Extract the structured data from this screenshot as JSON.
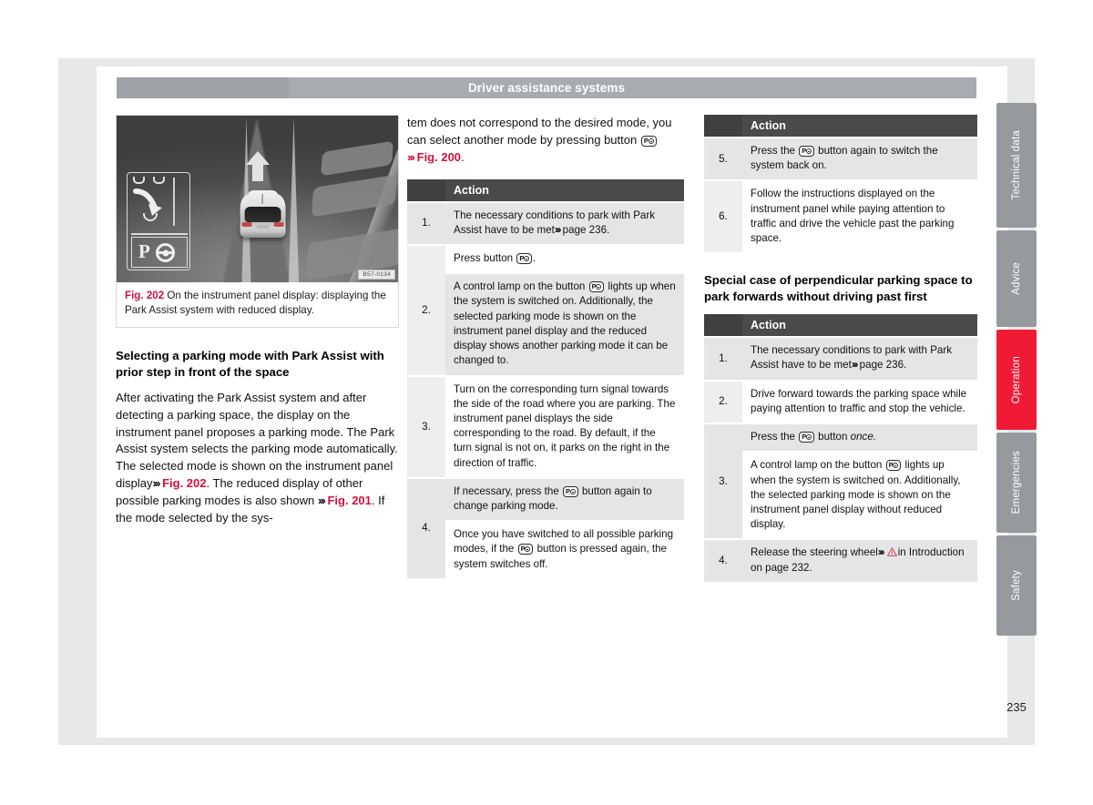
{
  "header": {
    "title": "Driver assistance systems"
  },
  "page_number": "235",
  "figure": {
    "code": "B57-0134",
    "label": "Fig. 202",
    "caption": "On the instrument panel display: displaying the Park Assist system with reduced display."
  },
  "left_column": {
    "heading": "Selecting a parking mode with Park Assist with prior step in front of the space",
    "paragraph_part1": "After activating the Park Assist system and after detecting a parking space, the display on the instrument panel proposes a parking mode. The Park Assist system selects the parking mode automatically. The selected mode is shown on the instrument panel display",
    "ref1": "Fig. 202",
    "paragraph_part2": ". The reduced display of other possible parking modes is also shown",
    "ref2": "Fig. 201",
    "paragraph_part3": ". If the mode selected by the sys-"
  },
  "middle_column": {
    "intro_part1": "tem does not correspond to the desired mode, you can select another mode by pressing button",
    "intro_ref": "Fig. 200",
    "intro_part2": ".",
    "table": {
      "header_num": "",
      "header_action": "Action",
      "rows": [
        {
          "num": "1.",
          "cells": [
            {
              "shade": true,
              "text_before": "The necessary conditions to park with Park Assist have to be met",
              "chevron": true,
              "text_after": "page 236.",
              "button": false
            }
          ]
        },
        {
          "num": "2.",
          "cells": [
            {
              "shade": false,
              "text_before": "Press button",
              "button": true,
              "text_after": "."
            },
            {
              "shade": true,
              "text_before": "A control lamp on the button",
              "button": true,
              "text_after": "lights up when the system is switched on. Additionally, the selected parking mode is shown on the instrument panel display and the reduced display shows another parking mode it can be changed to."
            }
          ]
        },
        {
          "num": "3.",
          "cells": [
            {
              "shade": false,
              "text_before": "Turn on the corresponding turn signal towards the side of the road where you are parking. The instrument panel displays the side corresponding to the road. By default, if the turn signal is not on, it parks on the right in the direction of traffic.",
              "button": false,
              "text_after": ""
            }
          ]
        },
        {
          "num": "4.",
          "cells": [
            {
              "shade": true,
              "text_before": "If necessary, press the",
              "button": true,
              "text_after": "button again to change parking mode."
            },
            {
              "shade": false,
              "text_before": "Once you have switched to all possible parking modes, if the",
              "button": true,
              "text_after": "button is pressed again, the system switches off."
            }
          ]
        }
      ]
    }
  },
  "right_column": {
    "table1": {
      "header_num": "",
      "header_action": "Action",
      "rows": [
        {
          "num": "5.",
          "cells": [
            {
              "shade": true,
              "text_before": "Press the",
              "button": true,
              "text_after": "button again to switch the system back on."
            }
          ]
        },
        {
          "num": "6.",
          "cells": [
            {
              "shade": false,
              "text_before": "Follow the instructions displayed on the instrument panel while paying attention to traffic and drive the vehicle past the parking space.",
              "button": false,
              "text_after": ""
            }
          ]
        }
      ]
    },
    "heading": "Special case of perpendicular parking space to park forwards without driving past first",
    "table2": {
      "header_num": "",
      "header_action": "Action",
      "rows": [
        {
          "num": "1.",
          "cells": [
            {
              "shade": true,
              "text_before": "The necessary conditions to park with Park Assist have to be met",
              "chevron": true,
              "text_after": "page 236.",
              "button": false
            }
          ]
        },
        {
          "num": "2.",
          "cells": [
            {
              "shade": false,
              "text_before": "Drive forward towards the parking space while paying attention to traffic and stop the vehicle.",
              "button": false,
              "text_after": ""
            }
          ]
        },
        {
          "num": "3.",
          "cells": [
            {
              "shade": true,
              "text_before": "Press the",
              "button": true,
              "text_after": "button ",
              "italic_tail": "once."
            },
            {
              "shade": false,
              "text_before": "A control lamp on the button",
              "button": true,
              "text_after": "lights up when the system is switched on. Additionally, the selected parking mode is shown on the instrument panel display without reduced display."
            }
          ]
        },
        {
          "num": "4.",
          "cells": [
            {
              "shade": true,
              "text_before": "Release the steering wheel",
              "chevron": true,
              "warning": true,
              "text_after": "in Introduction on page 232.",
              "button": false
            }
          ]
        }
      ]
    }
  },
  "side_tabs": [
    {
      "label": "Technical data",
      "active": false,
      "height": 137
    },
    {
      "label": "Advice",
      "active": false,
      "height": 106
    },
    {
      "label": "Operation",
      "active": true,
      "height": 110
    },
    {
      "label": "Emergencies",
      "active": false,
      "height": 110
    },
    {
      "label": "Safety",
      "active": false,
      "height": 110
    }
  ],
  "colors": {
    "accent_red": "#d3103c",
    "tab_active": "#f01a35",
    "tab_inactive": "#96999e",
    "header_bar": "#a8abb0",
    "table_header": "#494a4c"
  }
}
